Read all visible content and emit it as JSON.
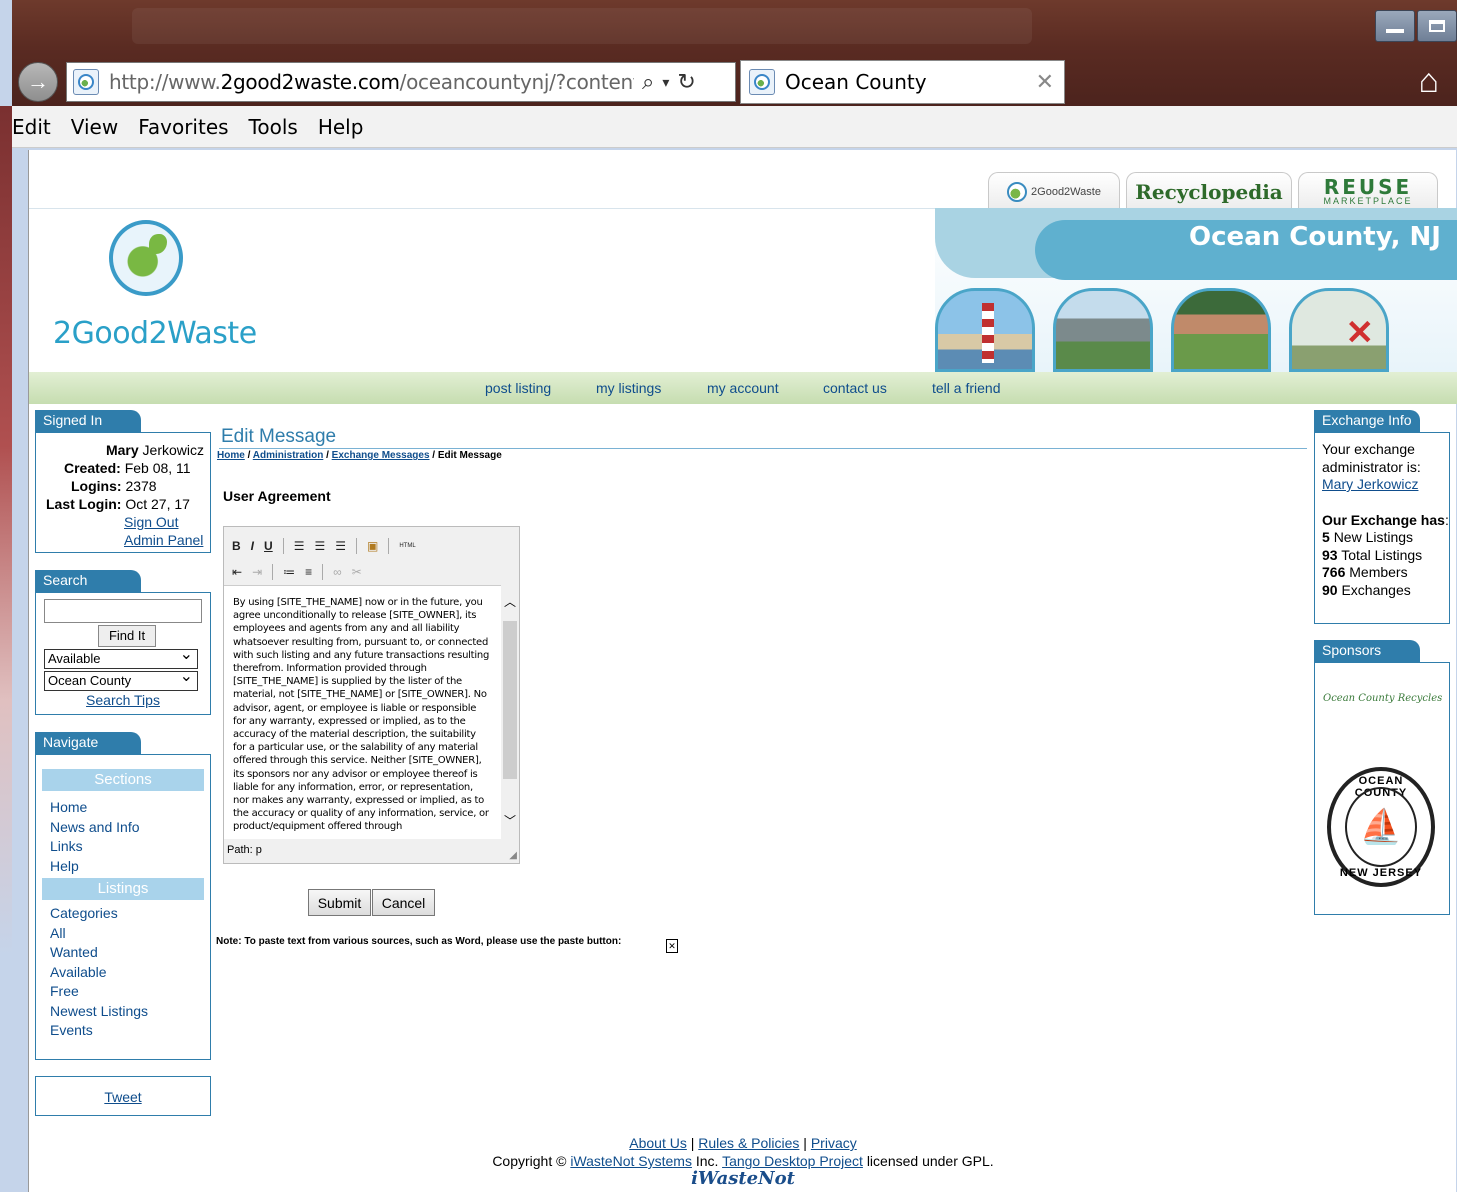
{
  "browser": {
    "url_prefix": "http://www.",
    "url_domain": "2good2waste.com",
    "url_rest": "/oceancountynj/?content=adr",
    "tab_title": "Ocean County",
    "menu": [
      "Edit",
      "View",
      "Favorites",
      "Tools",
      "Help"
    ]
  },
  "site": {
    "logo_text": "2Good2Waste",
    "tabs": {
      "twogood": "2Good2Waste",
      "recyclopedia": "Recyclopedia",
      "reuse": "REUSE",
      "reuse_sub": "MARKETPLACE"
    },
    "banner_title": "Ocean County, NJ",
    "nav": [
      "post listing",
      "my listings",
      "my account",
      "contact us",
      "tell a friend"
    ]
  },
  "signed_in": {
    "tab": "Signed In",
    "first_name": "Mary",
    "last_name": "Jerkowicz",
    "created_label": "Created:",
    "created": "Feb 08, 11",
    "logins_label": "Logins:",
    "logins": "2378",
    "last_login_label": "Last Login:",
    "last_login": "Oct 27, 17",
    "sign_out": "Sign Out",
    "admin_panel": "Admin Panel"
  },
  "search": {
    "tab": "Search",
    "input_value": "",
    "find_button": "Find It",
    "type_selected": "Available",
    "area_selected": "Ocean County",
    "tips": "Search Tips"
  },
  "navigate": {
    "tab": "Navigate",
    "sections_header": "Sections",
    "sections": [
      "Home",
      "News and Info",
      "Links",
      "Help"
    ],
    "listings_header": "Listings",
    "listings": [
      "Categories",
      "All",
      "Wanted",
      "Available",
      "Free",
      "Newest Listings",
      "Events"
    ]
  },
  "tweet": "Tweet",
  "main": {
    "title": "Edit Message",
    "breadcrumb": [
      "Home",
      "Administration",
      "Exchange Messages",
      "Edit Message"
    ],
    "section_label": "User Agreement",
    "toolbar": {
      "bold": "B",
      "italic": "I",
      "underline": "U",
      "html": "HTML"
    },
    "editor_text": "By using [SITE_THE_NAME] now or in the future, you agree unconditionally to release [SITE_OWNER], its employees and agents from any and all liability whatsoever resulting from, pursuant to, or connected with such listing and any future transactions resulting therefrom. Information provided through [SITE_THE_NAME] is supplied by the lister of the material, not [SITE_THE_NAME] or [SITE_OWNER]. No advisor, agent, or employee is liable or responsible for any warranty, expressed or implied, as to the accuracy of the material description, the suitability for a particular use, or the salability of any material offered through this service. Neither [SITE_OWNER], its sponsors nor any advisor or employee thereof is liable for any information, error, or representation, nor makes any warranty, expressed or implied, as to the accuracy or quality of any information, service, or product/equipment offered through",
    "status_path": "Path: p",
    "submit": "Submit",
    "cancel": "Cancel",
    "note": "Note: To paste text from various sources, such as Word, please use the paste button:"
  },
  "exchange": {
    "tab": "Exchange Info",
    "admin_text": "Your exchange administrator is:",
    "admin_name": "Mary Jerkowicz",
    "has_label": "Our Exchange has",
    "has_colon": ":",
    "stats": [
      {
        "num": "5",
        "label": "New Listings"
      },
      {
        "num": "93",
        "label": "Total Listings"
      },
      {
        "num": "766",
        "label": "Members"
      },
      {
        "num": "90",
        "label": "Exchanges"
      }
    ]
  },
  "sponsors": {
    "tab": "Sponsors",
    "sponsor1": "Ocean County Recycles",
    "seal_top": "OCEAN COUNTY",
    "seal_bottom": "NEW JERSEY"
  },
  "footer": {
    "about": "About Us",
    "rules": "Rules & Policies",
    "privacy": "Privacy",
    "copyright": "Copyright ©",
    "iwastenot_systems": "iWasteNot Systems",
    "inc": "Inc.",
    "tango": "Tango Desktop Project",
    "licensed": "licensed under GPL.",
    "logo": "iWasteNot"
  }
}
